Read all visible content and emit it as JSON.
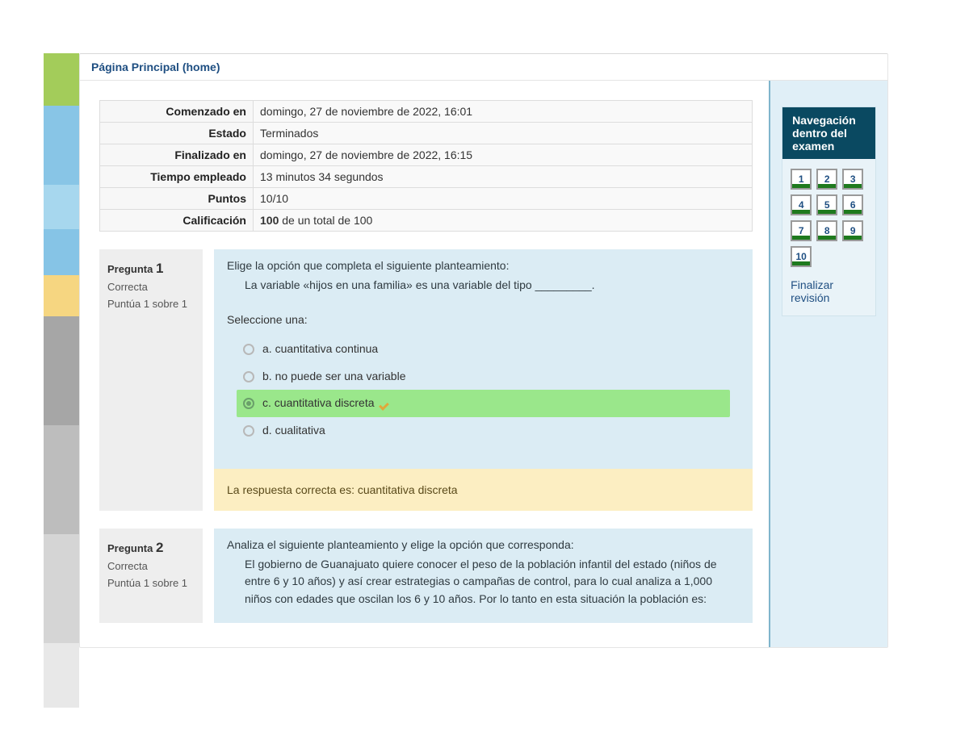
{
  "breadcrumb": {
    "home": "Página Principal (home)"
  },
  "summary": {
    "rows": [
      {
        "label": "Comenzado en",
        "value": "domingo, 27 de noviembre de 2022, 16:01"
      },
      {
        "label": "Estado",
        "value": "Terminados"
      },
      {
        "label": "Finalizado en",
        "value": "domingo, 27 de noviembre de 2022, 16:15"
      },
      {
        "label": "Tiempo empleado",
        "value": "13 minutos 34 segundos"
      },
      {
        "label": "Puntos",
        "value": "10/10"
      },
      {
        "label": "Calificación",
        "value_html": "<b>100</b> de un total de 100"
      }
    ]
  },
  "question_label": "Pregunta",
  "select_one": "Seleccione una:",
  "questions": [
    {
      "number": "1",
      "state": "Correcta",
      "grade": "Puntúa 1 sobre 1",
      "text_line1": "Elige la opción que completa el siguiente planteamiento:",
      "text_line2": "La variable «hijos en una familia» es una variable del tipo _________.",
      "options": [
        {
          "letter": "a.",
          "text": "cuantitativa continua",
          "selected": false,
          "correct": false
        },
        {
          "letter": "b.",
          "text": "no puede ser una variable",
          "selected": false,
          "correct": false
        },
        {
          "letter": "c.",
          "text": "cuantitativa discreta",
          "selected": true,
          "correct": true
        },
        {
          "letter": "d.",
          "text": "cualitativa",
          "selected": false,
          "correct": false
        }
      ],
      "feedback": "La respuesta correcta es: cuantitativa discreta"
    },
    {
      "number": "2",
      "state": "Correcta",
      "grade": "Puntúa 1 sobre 1",
      "text_line1": "Analiza el siguiente planteamiento y elige la opción que corresponda:",
      "text_line2": "El gobierno de Guanajuato quiere conocer el peso de la población infantil del estado (niños de entre 6 y 10 años) y así crear estrategias o campañas de control, para lo cual analiza a 1,000 niños con edades que oscilan los 6 y 10 años. Por lo tanto en esta situación la población es:"
    }
  ],
  "nav": {
    "title": "Navegación dentro del examen",
    "items": [
      "1",
      "2",
      "3",
      "4",
      "5",
      "6",
      "7",
      "8",
      "9",
      "10"
    ],
    "finish": "Finalizar revisión"
  }
}
